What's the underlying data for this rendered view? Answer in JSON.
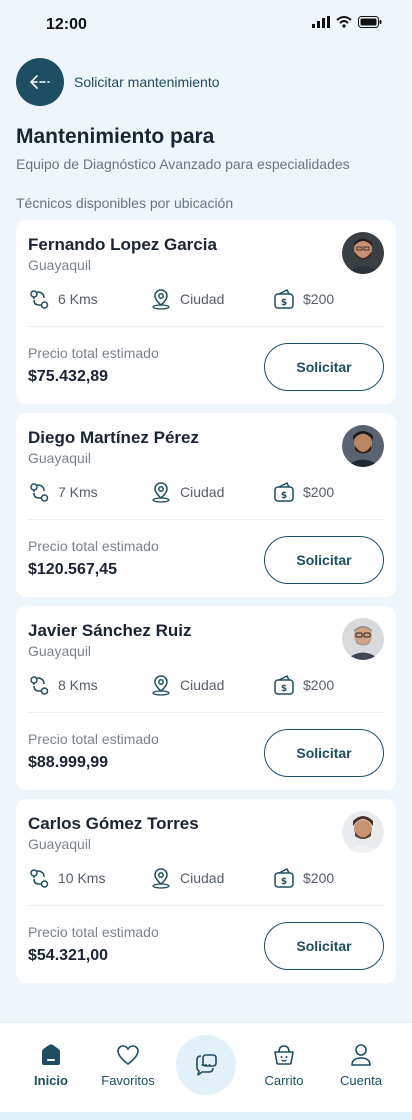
{
  "status_bar": {
    "time": "12:00"
  },
  "header": {
    "title": "Solicitar mantenimiento"
  },
  "page": {
    "title": "Mantenimiento para",
    "subtitle": "Equipo de Diagnóstico Avanzado para especialidades",
    "section_label": "Técnicos disponibles por ubicación"
  },
  "technicians": [
    {
      "name": "Fernando Lopez Garcia",
      "city": "Guayaquil",
      "distance": "6 Kms",
      "zone": "Ciudad",
      "price": "$200",
      "total_label": "Precio total estimado",
      "total": "$75.432,89",
      "button_label": "Solicitar"
    },
    {
      "name": "Diego Martínez Pérez",
      "city": "Guayaquil",
      "distance": "7 Kms",
      "zone": "Ciudad",
      "price": "$200",
      "total_label": "Precio total estimado",
      "total": "$120.567,45",
      "button_label": "Solicitar"
    },
    {
      "name": "Javier Sánchez Ruiz",
      "city": "Guayaquil",
      "distance": "8 Kms",
      "zone": "Ciudad",
      "price": "$200",
      "total_label": "Precio total estimado",
      "total": "$88.999,99",
      "button_label": "Solicitar"
    },
    {
      "name": "Carlos Gómez Torres",
      "city": "Guayaquil",
      "distance": "10 Kms",
      "zone": "Ciudad",
      "price": "$200",
      "total_label": "Precio total estimado",
      "total": "$54.321,00",
      "button_label": "Solicitar"
    }
  ],
  "bottom_nav": {
    "items": [
      {
        "label": "Inicio",
        "icon": "home-icon",
        "active": true
      },
      {
        "label": "Favoritos",
        "icon": "heart-icon",
        "active": false
      },
      {
        "label": "",
        "icon": "chat-icon",
        "active": false
      },
      {
        "label": "Carrito",
        "icon": "cart-icon",
        "active": false
      },
      {
        "label": "Cuenta",
        "icon": "user-icon",
        "active": false
      }
    ]
  },
  "colors": {
    "primary": "#1d4e63",
    "background": "#eef6fb",
    "card": "#ffffff",
    "text": "#1a2433",
    "muted": "#7a838d"
  }
}
